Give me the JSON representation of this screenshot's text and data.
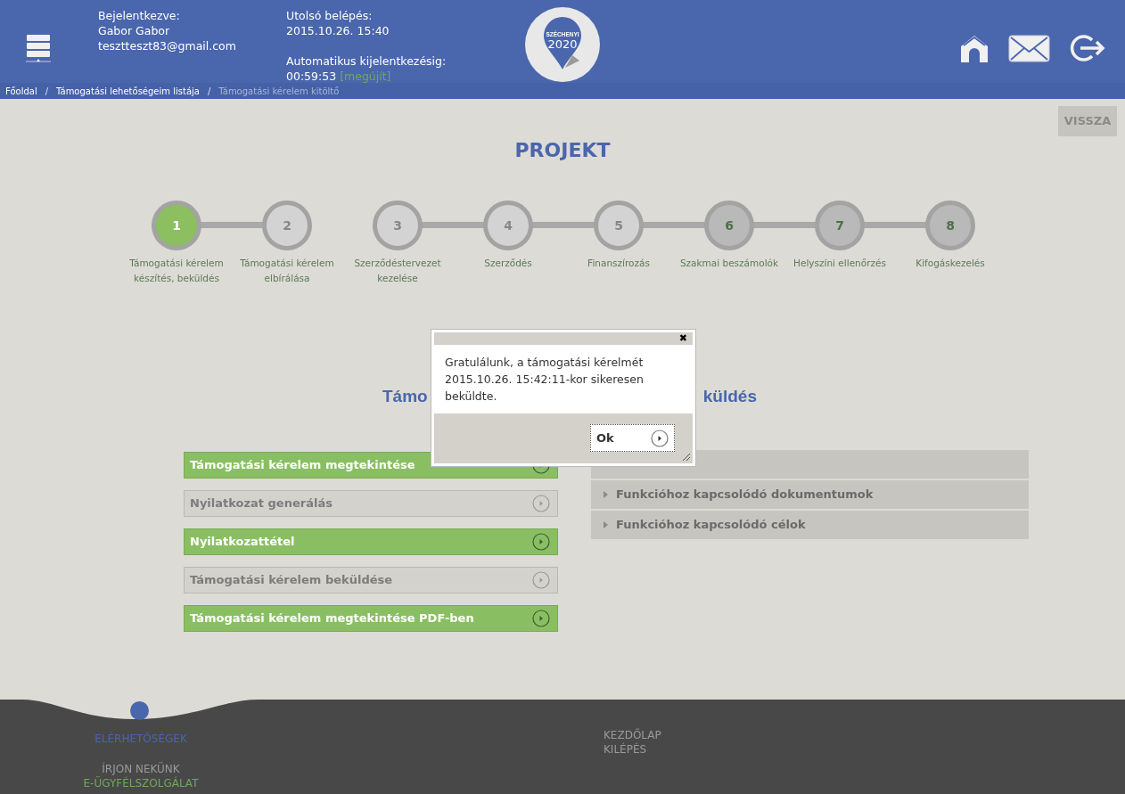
{
  "header": {
    "user_label": "Bejelentkezve:",
    "user_name": "Gabor Gabor",
    "user_email": "tesztteszt83@gmail.com",
    "last_login_label": "Utolsó belépés:",
    "last_login": "2015.10.26. 15:40",
    "auto_logout_label": "Automatikus kijelentkezésig:",
    "auto_logout_time": "00:59:53",
    "renew_link": "[megújít]",
    "logo_text": "SZÉCHENYI",
    "logo_year": "2020"
  },
  "breadcrumb": [
    {
      "label": "Főoldal",
      "current": false
    },
    {
      "label": "Támogatási lehetőségeim listája",
      "current": false
    },
    {
      "label": "Támogatási kérelem kitöltő",
      "current": true
    }
  ],
  "breadcrumb_separator": "/",
  "back_button": "VISSZA",
  "title": "PROJEKT",
  "steps": [
    {
      "number": "1",
      "label": "Támogatási kérelem készítés, beküldés",
      "selected": true,
      "linked_to_next": true
    },
    {
      "number": "2",
      "label": "Támogatási kérelem elbírálása",
      "selected": false,
      "enabled": false,
      "linked_to_next": false
    },
    {
      "number": "3",
      "label": "Szerződéstervezet kezelése",
      "selected": false,
      "enabled": false,
      "linked_to_next": true
    },
    {
      "number": "4",
      "label": "Szerződés",
      "selected": false,
      "enabled": false,
      "linked_to_next": true
    },
    {
      "number": "5",
      "label": "Finanszírozás",
      "selected": false,
      "enabled": false,
      "linked_to_next": true
    },
    {
      "number": "6",
      "label": "Szakmai beszámolók",
      "selected": false,
      "enabled": true,
      "linked_to_next": true
    },
    {
      "number": "7",
      "label": "Helyszíni ellenőrzés",
      "selected": false,
      "enabled": true,
      "linked_to_next": true
    },
    {
      "number": "8",
      "label": "Kifogáskezelés",
      "selected": false,
      "enabled": true,
      "linked_to_next": false
    }
  ],
  "section_heading": {
    "left_part": "Támo",
    "right_part": "küldés"
  },
  "actions": [
    {
      "label": "Támogatási kérelem megtekintése",
      "enabled": true
    },
    {
      "label": "Nyilatkozat generálás",
      "enabled": false
    },
    {
      "label": "Nyilatkozattétel",
      "enabled": true
    },
    {
      "label": "Támogatási kérelem beküldése",
      "enabled": false
    },
    {
      "label": "Támogatási kérelem megtekintése PDF-ben",
      "enabled": true
    }
  ],
  "info_panels": [
    {
      "label": "Funkcióhoz kapcsolódó dokumentumok"
    },
    {
      "label": "Funkcióhoz kapcsolódó célok"
    }
  ],
  "dialog": {
    "close": "✖",
    "message": "Gratulálunk, a támogatási kérelmét 2015.10.26. 15:42:11-kor sikeresen beküldte.",
    "ok_button": "Ok"
  },
  "footer": {
    "contacts": "ELÉRHETŐSÉGEK",
    "write_us": "ÍRJON NEKÜNK",
    "customer_service": "E-ÜGYFÉLSZOLGÁLAT",
    "links": [
      "KEZDŐLAP",
      "KILÉPÉS"
    ]
  }
}
